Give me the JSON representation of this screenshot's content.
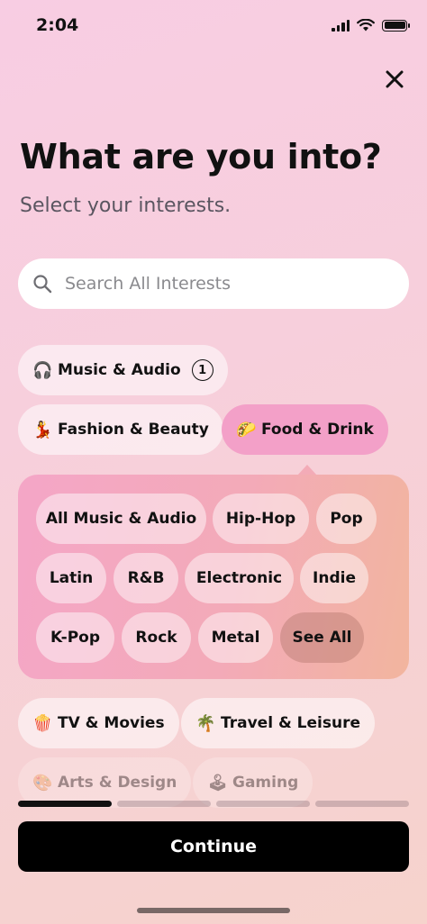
{
  "status_bar": {
    "time": "2:04"
  },
  "header": {
    "close_icon": "close-icon"
  },
  "title": "What are you into?",
  "subtitle": "Select your interests.",
  "search": {
    "placeholder": "Search All Interests",
    "value": ""
  },
  "categories": [
    {
      "label": "Music & Audio",
      "icon": "headphones-icon",
      "emoji": "🎧",
      "selected_count": "1"
    },
    {
      "label": "Fashion & Beauty",
      "icon": "dancer-icon",
      "emoji": "💃"
    },
    {
      "label": "Food & Drink",
      "icon": "taco-icon",
      "emoji": "🌮",
      "active": true
    },
    {
      "label": "TV & Movies",
      "icon": "popcorn-icon",
      "emoji": "🍿"
    },
    {
      "label": "Travel & Leisure",
      "icon": "palm-tree-icon",
      "emoji": "🌴"
    },
    {
      "label": "Arts & Design",
      "icon": "palette-icon",
      "emoji": "🎨"
    },
    {
      "label": "Gaming",
      "icon": "joystick-icon",
      "emoji": "🕹"
    }
  ],
  "subcategories": [
    {
      "label": "All Music & Audio"
    },
    {
      "label": "Hip-Hop"
    },
    {
      "label": "Pop"
    },
    {
      "label": "Latin"
    },
    {
      "label": "R&B"
    },
    {
      "label": "Electronic"
    },
    {
      "label": "Indie"
    },
    {
      "label": "K-Pop"
    },
    {
      "label": "Rock"
    },
    {
      "label": "Metal"
    },
    {
      "label": "See All"
    }
  ],
  "progress": {
    "current_step": 1,
    "total_steps": 4
  },
  "continue_label": "Continue",
  "colors": {
    "active_chip": "#f3a0c8",
    "button": "#000000",
    "background": "#f8cde3"
  }
}
